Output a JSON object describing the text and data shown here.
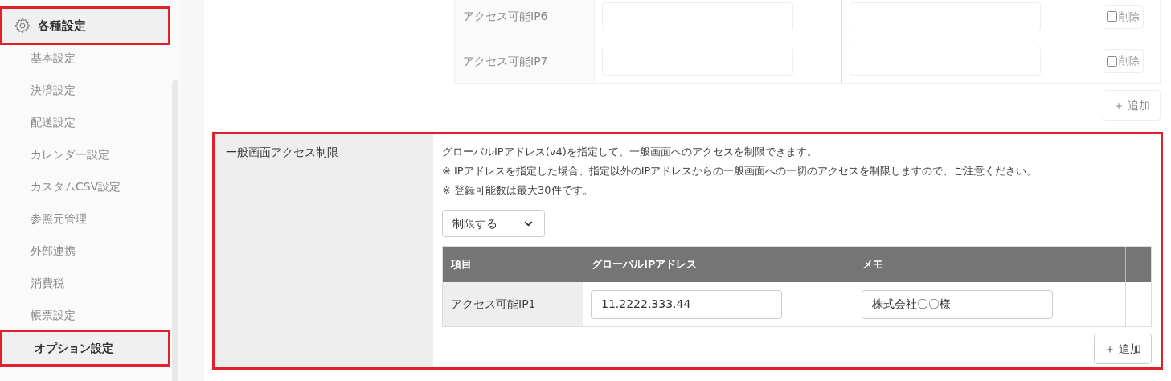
{
  "sidebar": {
    "header": {
      "label": "各種設定",
      "highlighted": true
    },
    "items": [
      {
        "label": "基本設定",
        "highlighted": false
      },
      {
        "label": "決済設定",
        "highlighted": false
      },
      {
        "label": "配送設定",
        "highlighted": false
      },
      {
        "label": "カレンダー設定",
        "highlighted": false
      },
      {
        "label": "カスタムCSV設定",
        "highlighted": false
      },
      {
        "label": "参照元管理",
        "highlighted": false
      },
      {
        "label": "外部連携",
        "highlighted": false
      },
      {
        "label": "消費税",
        "highlighted": false
      },
      {
        "label": "帳票設定",
        "highlighted": false
      },
      {
        "label": "オプション設定",
        "highlighted": true
      }
    ]
  },
  "sections": [
    {
      "highlighted": false,
      "rows": [
        {
          "label": "アクセス可能IP6",
          "delete": {
            "label": "削除",
            "checked": false
          }
        },
        {
          "label": "アクセス可能IP7",
          "delete": {
            "label": "削除",
            "checked": false
          }
        }
      ],
      "add_button": "＋ 追加"
    },
    {
      "highlighted": true,
      "label": "一般画面アクセス制限",
      "description": [
        "グローバルIPアドレス(v4)を指定して、一般画面へのアクセスを制限できます。",
        "※ IPアドレスを指定した場合、指定以外のIPアドレスからの一般画面への一切のアクセスを制限しますので、ご注意ください。",
        "※ 登録可能数は最大30件です。"
      ],
      "select": {
        "value": "制限する"
      },
      "columns": [
        "項目",
        "グローバルIPアドレス",
        "メモ"
      ],
      "rows": [
        {
          "label": "アクセス可能IP1",
          "address": "11.2222.333.44",
          "memo": "株式会社〇〇様"
        }
      ],
      "add_button": "＋ 追加"
    }
  ]
}
